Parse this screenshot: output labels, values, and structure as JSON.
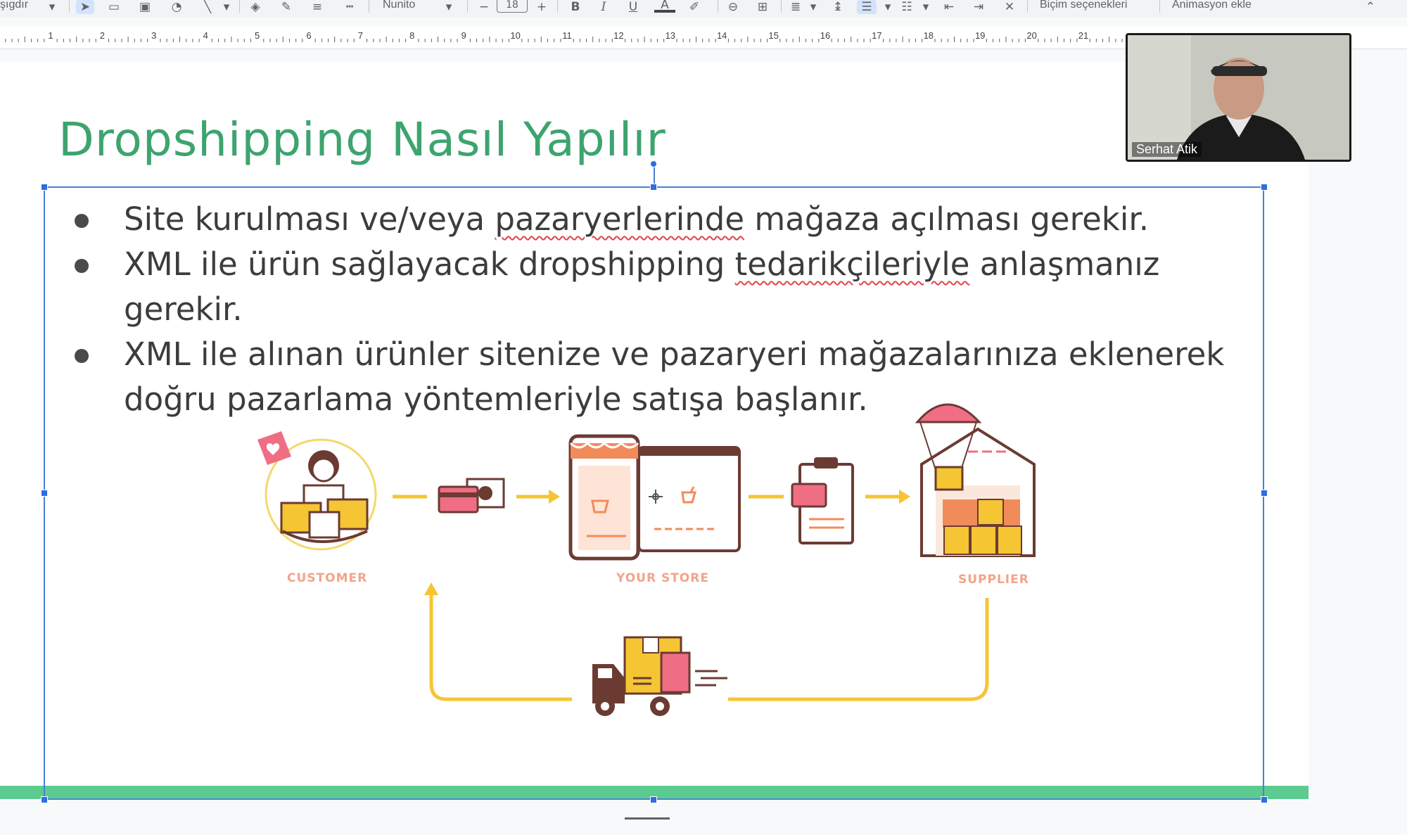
{
  "toolbar": {
    "paste_label": "şıgdır",
    "font_name": "Nunito",
    "font_size": "18",
    "format_options": "Biçim seçenekleri",
    "animation": "Animasyon ekle",
    "ruler_ticks": [
      "1",
      "2",
      "3",
      "4",
      "5",
      "6",
      "7",
      "8",
      "9",
      "10",
      "11",
      "12",
      "13",
      "14",
      "15",
      "16",
      "17",
      "18",
      "19",
      "20",
      "21"
    ],
    "icons": [
      "select-arrow-icon",
      "textbox-icon",
      "image-icon",
      "shape-icon",
      "line-icon",
      "fill-color-icon",
      "pen-icon",
      "border-weight-icon",
      "border-dash-icon",
      "bold-icon",
      "italic-icon",
      "underline-icon",
      "text-color-icon",
      "highlight-icon",
      "link-icon",
      "comment-icon",
      "align-icon",
      "line-spacing-icon",
      "bulleted-list-icon",
      "numbered-list-icon",
      "decrease-indent-icon",
      "increase-indent-icon",
      "clear-format-icon",
      "collapse-icon"
    ]
  },
  "slide": {
    "title": "Dropshipping Nasıl Yapılır",
    "bullets": [
      {
        "before": "Site kurulması ve/veya ",
        "marked": "pazaryerlerinde",
        "after": " mağaza açılması gerekir."
      },
      {
        "before": "XML ile ürün sağlayacak dropshipping ",
        "marked": "tedarikçileriyle",
        "after": " anlaşmanız gerekir."
      },
      {
        "before": "XML ile alınan ürünler sitenize ve pazaryeri mağazalarınıza eklenerek doğru pazarlama yöntemleriyle satışa başlanır.",
        "marked": "",
        "after": ""
      }
    ],
    "diagram": {
      "customer_label": "CUSTOMER",
      "store_label": "YOUR STORE",
      "supplier_label": "SUPPLIER"
    },
    "colors": {
      "title": "#3da46f",
      "accent_bar": "#5ccb90",
      "arrow": "#f5c533",
      "selection": "#4a7fd6"
    }
  },
  "webcam": {
    "name": "Serhat Atik"
  }
}
